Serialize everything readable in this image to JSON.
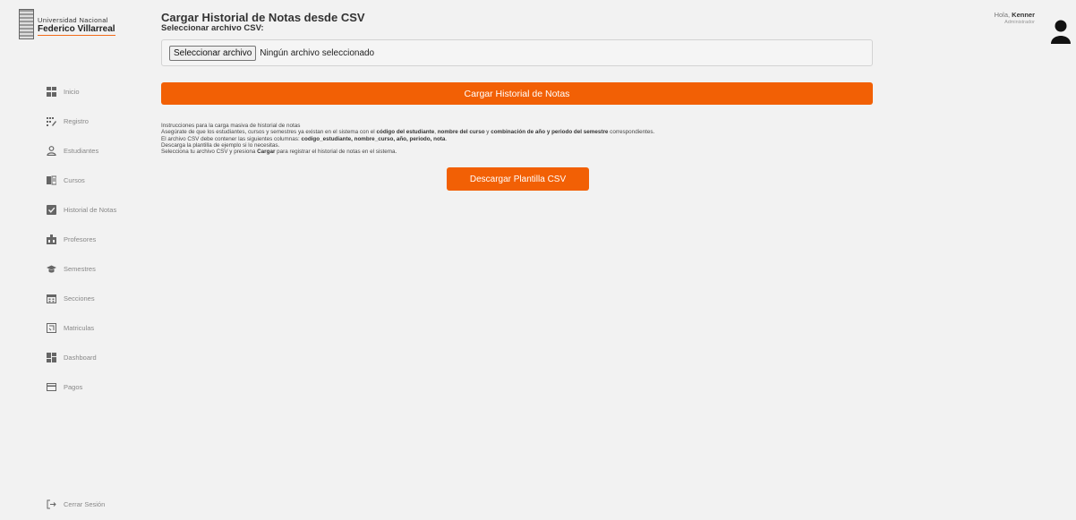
{
  "brand": {
    "line1": "Universidad Nacional",
    "line2": "Federico Villarreal"
  },
  "sidebar": {
    "items": [
      {
        "label": "Inicio",
        "icon": "grid-icon"
      },
      {
        "label": "Registro",
        "icon": "registry-icon"
      },
      {
        "label": "Estudiantes",
        "icon": "user-icon"
      },
      {
        "label": "Cursos",
        "icon": "book-icon"
      },
      {
        "label": "Historial de Notas",
        "icon": "checklist-icon"
      },
      {
        "label": "Profesores",
        "icon": "teacher-icon"
      },
      {
        "label": "Semestres",
        "icon": "graduation-cap-icon"
      },
      {
        "label": "Secciones",
        "icon": "calendar-icon"
      },
      {
        "label": "Matriculas",
        "icon": "enrollment-icon"
      },
      {
        "label": "Dashboard",
        "icon": "dashboard-icon"
      },
      {
        "label": "Pagos",
        "icon": "card-icon"
      }
    ],
    "logout": "Cerrar Sesión"
  },
  "main": {
    "title": "Cargar Historial de Notas desde CSV",
    "file_label": "Seleccionar archivo CSV:",
    "file_button": "Seleccionar archivo",
    "file_status": "Ningún archivo seleccionado",
    "upload_button": "Cargar Historial de Notas",
    "instructions": {
      "heading": "Instrucciones para la carga masiva de historial de notas",
      "l1_a": "Asegúrate de que los estudiantes, cursos y semestres ya existan en el sistema con el ",
      "l1_b1": "código del estudiante",
      "l1_c": ", ",
      "l1_b2": "nombre del curso",
      "l1_d": " y ",
      "l1_b3": "combinación de año y periodo del semestre",
      "l1_e": " correspondientes.",
      "l2_a": "El archivo CSV debe contener las siguientes columnas: ",
      "l2_b": "codigo_estudiante, nombre_curso, año, periodo, nota",
      "l2_c": ".",
      "l3": "Descarga la plantilla de ejemplo si lo necesitas.",
      "l4_a": "Selecciona tu archivo CSV y presiona ",
      "l4_b": "Cargar",
      "l4_c": " para registrar el historial de notas en el sistema."
    },
    "download_button": "Descargar Plantilla CSV"
  },
  "user": {
    "greeting": "Hola, ",
    "name": "Kenner",
    "role": "Administrador"
  },
  "colors": {
    "accent": "#f26005",
    "background": "#f2f2f2"
  }
}
